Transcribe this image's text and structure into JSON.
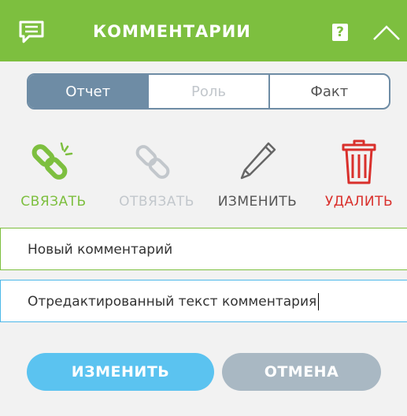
{
  "header": {
    "title": "КОММЕНТАРИИ",
    "help_label": "?",
    "icon": "comment-icon",
    "collapse_icon": "chevron-up-icon"
  },
  "tabs": [
    {
      "label": "Отчет",
      "state": "active"
    },
    {
      "label": "Роль",
      "state": "disabled"
    },
    {
      "label": "Факт",
      "state": "normal"
    }
  ],
  "actions": [
    {
      "label": "СВЯЗАТЬ",
      "icon": "link-icon",
      "color": "#7dbf3f"
    },
    {
      "label": "ОТВЯЗАТЬ",
      "icon": "unlink-icon",
      "color": "#c2c7cc"
    },
    {
      "label": "ИЗМЕНИТЬ",
      "icon": "pencil-icon",
      "color": "#555555"
    },
    {
      "label": "УДАЛИТЬ",
      "icon": "trash-icon",
      "color": "#d9302c"
    }
  ],
  "fields": {
    "new_comment": "Новый комментарий",
    "edited_comment": "Отредактированный текст комментария"
  },
  "buttons": {
    "save": "ИЗМЕНИТЬ",
    "cancel": "ОТМЕНА"
  },
  "colors": {
    "header": "#7dbf3f",
    "tab_active": "#6e8ca5",
    "save_button": "#5bc3f0",
    "cancel_button": "#a9b8c3",
    "delete": "#d9302c"
  }
}
